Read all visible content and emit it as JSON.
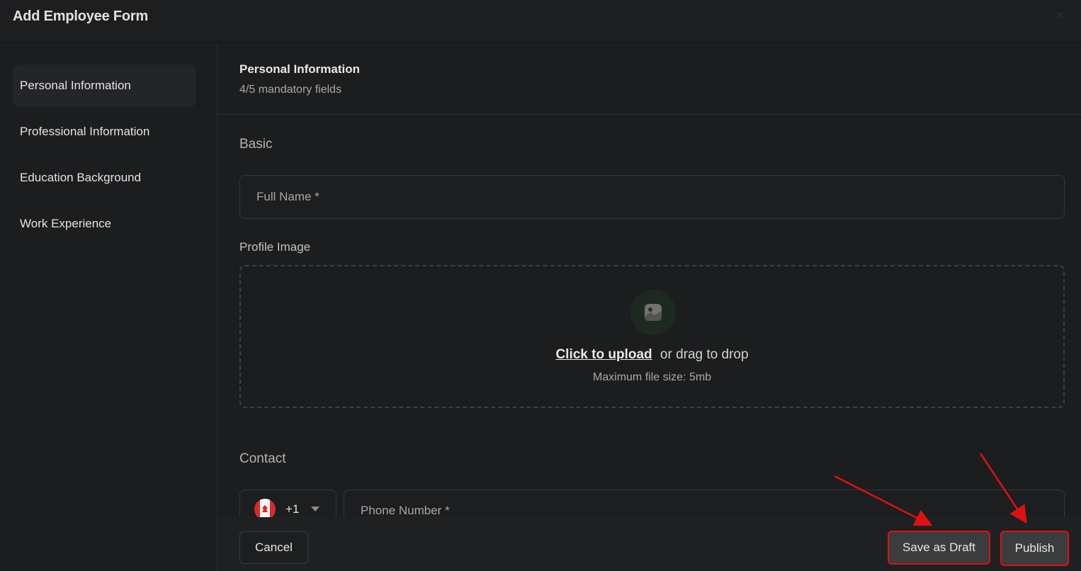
{
  "window": {
    "title": "Add Employee Form"
  },
  "sidebar": {
    "items": [
      {
        "label": "Personal Information",
        "active": true
      },
      {
        "label": "Professional Information",
        "active": false
      },
      {
        "label": "Education Background",
        "active": false
      },
      {
        "label": "Work Experience",
        "active": false
      }
    ]
  },
  "section": {
    "title": "Personal Information",
    "subtitle": "4/5 mandatory fields"
  },
  "basic": {
    "label": "Basic",
    "full_name_placeholder": "Full Name *",
    "profile_image_label": "Profile Image",
    "upload": {
      "link": "Click to upload",
      "text": "or drag to drop",
      "hint": "Maximum file size: 5mb",
      "icon": "image-icon"
    }
  },
  "contact": {
    "label": "Contact",
    "country_code": "+1",
    "country_flag": "canada-flag-icon",
    "phone_placeholder": "Phone Number *"
  },
  "footer": {
    "cancel_label": "Cancel",
    "draft_label": "Save as Draft",
    "publish_label": "Publish"
  },
  "colors": {
    "background": "#1b1d1f",
    "annotation": "#e01010",
    "button": "#3a3c3e"
  }
}
